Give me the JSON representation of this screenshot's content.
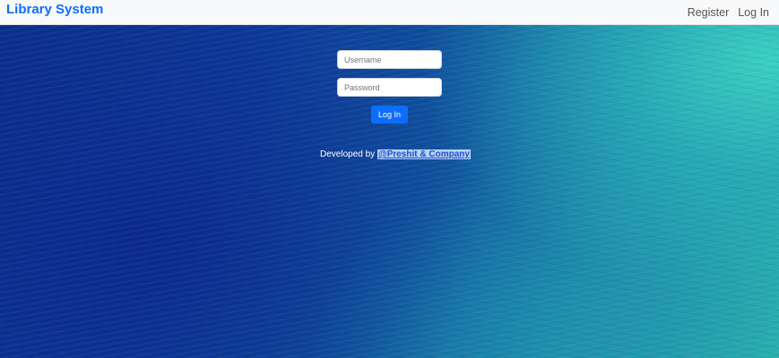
{
  "navbar": {
    "brand": "Library System",
    "links": [
      {
        "label": "Register"
      },
      {
        "label": "Log In"
      }
    ]
  },
  "login_form": {
    "username_placeholder": "Username",
    "password_placeholder": "Password",
    "submit_label": "Log In"
  },
  "footer": {
    "prefix": "Developed by",
    "credit": "@Preshit & Company"
  },
  "colors": {
    "brand": "#0d6efd",
    "button": "#0d6efd",
    "navbar_bg": "#f8f9fa"
  }
}
